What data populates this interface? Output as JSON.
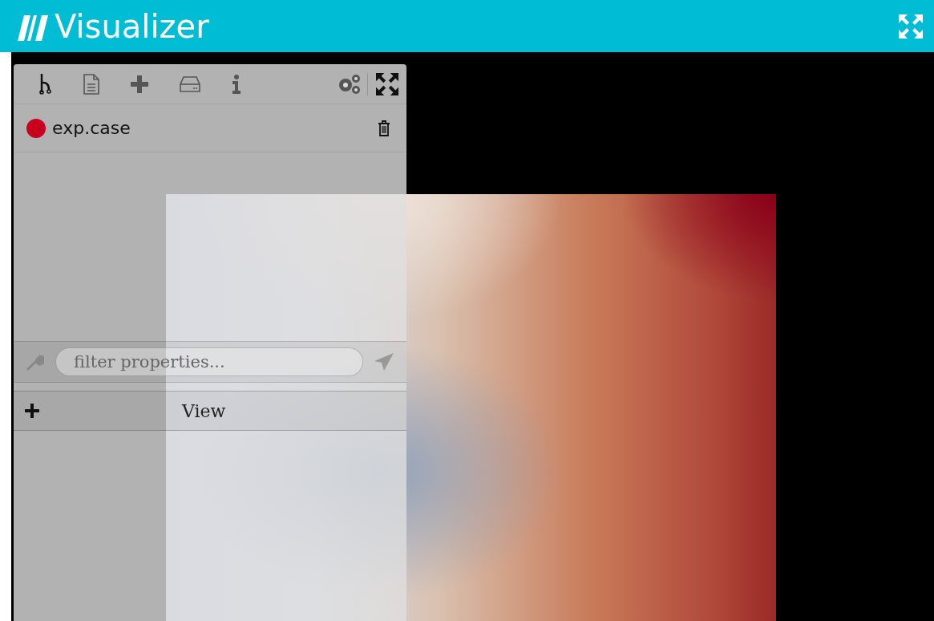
{
  "app": {
    "title": "Visualizer"
  },
  "pipeline": [
    {
      "name": "exp.case",
      "color": "#c8001e"
    }
  ],
  "filter": {
    "placeholder": "filter properties..."
  },
  "sections": [
    {
      "label": "View",
      "expanded": false
    }
  ]
}
